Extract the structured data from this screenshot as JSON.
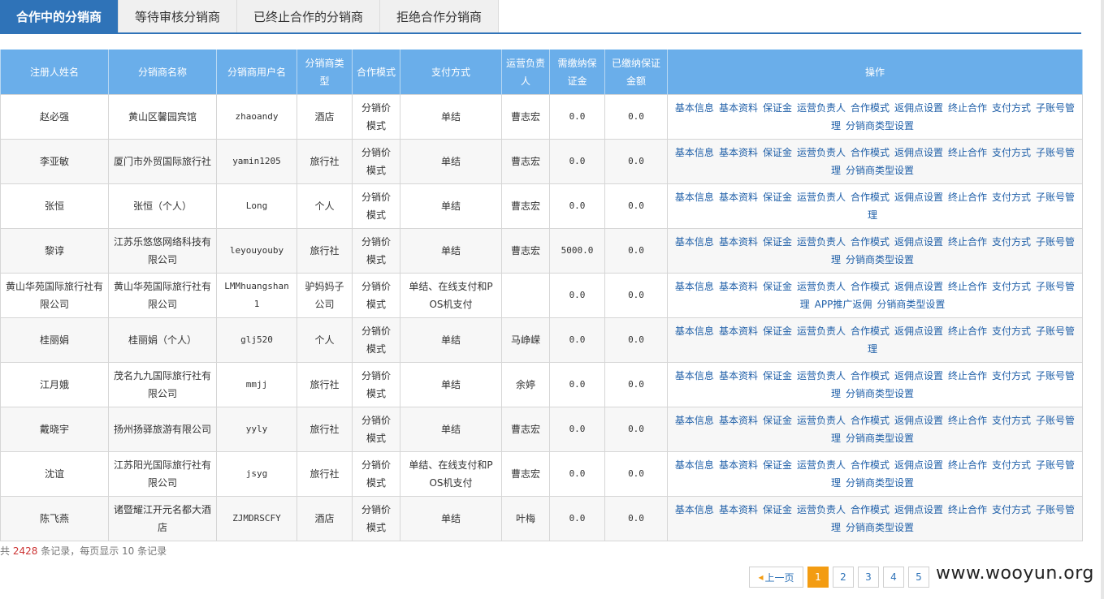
{
  "tabs": [
    {
      "label": "合作中的分销商",
      "active": true
    },
    {
      "label": "等待审核分销商",
      "active": false
    },
    {
      "label": "已终止合作的分销商",
      "active": false
    },
    {
      "label": "拒绝合作分销商",
      "active": false
    }
  ],
  "table": {
    "headers": [
      "注册人姓名",
      "分销商名称",
      "分销商用户名",
      "分销商类型",
      "合作模式",
      "支付方式",
      "运营负责人",
      "需缴纳保证金",
      "已缴纳保证金额",
      "操作"
    ],
    "rows": [
      {
        "registrant": "赵必强",
        "distributor_name": "黄山区馨园宾馆",
        "username": "zhaoandy",
        "type": "酒店",
        "mode": "分销价模式",
        "payment": "单结",
        "operator": "曹志宏",
        "deposit_required": "0.0",
        "deposit_paid": "0.0",
        "ops": [
          "基本信息",
          "基本资料",
          "保证金",
          "运营负责人",
          "合作模式",
          "返佣点设置",
          "终止合作",
          "支付方式",
          "子账号管理",
          "分销商类型设置"
        ]
      },
      {
        "registrant": "李亚敏",
        "distributor_name": "厦门市外贸国际旅行社",
        "username": "yamin1205",
        "type": "旅行社",
        "mode": "分销价模式",
        "payment": "单结",
        "operator": "曹志宏",
        "deposit_required": "0.0",
        "deposit_paid": "0.0",
        "ops": [
          "基本信息",
          "基本资料",
          "保证金",
          "运营负责人",
          "合作模式",
          "返佣点设置",
          "终止合作",
          "支付方式",
          "子账号管理",
          "分销商类型设置"
        ]
      },
      {
        "registrant": "张恒",
        "distributor_name": "张恒（个人）",
        "username": "Long",
        "type": "个人",
        "mode": "分销价模式",
        "payment": "单结",
        "operator": "曹志宏",
        "deposit_required": "0.0",
        "deposit_paid": "0.0",
        "ops": [
          "基本信息",
          "基本资料",
          "保证金",
          "运营负责人",
          "合作模式",
          "返佣点设置",
          "终止合作",
          "支付方式",
          "子账号管理"
        ]
      },
      {
        "registrant": "黎谆",
        "distributor_name": "江苏乐悠悠网络科技有限公司",
        "username": "leyouyouby",
        "type": "旅行社",
        "mode": "分销价模式",
        "payment": "单结",
        "operator": "曹志宏",
        "deposit_required": "5000.0",
        "deposit_paid": "0.0",
        "ops": [
          "基本信息",
          "基本资料",
          "保证金",
          "运营负责人",
          "合作模式",
          "返佣点设置",
          "终止合作",
          "支付方式",
          "子账号管理",
          "分销商类型设置"
        ]
      },
      {
        "registrant": "黄山华苑国际旅行社有限公司",
        "distributor_name": "黄山华苑国际旅行社有限公司",
        "username": "LMMhuangshan1",
        "type": "驴妈妈子公司",
        "mode": "分销价模式",
        "payment": "单结、在线支付和POS机支付",
        "operator": "",
        "deposit_required": "0.0",
        "deposit_paid": "0.0",
        "ops": [
          "基本信息",
          "基本资料",
          "保证金",
          "运营负责人",
          "合作模式",
          "返佣点设置",
          "终止合作",
          "支付方式",
          "子账号管理",
          "APP推广返佣",
          "分销商类型设置"
        ]
      },
      {
        "registrant": "桂丽娟",
        "distributor_name": "桂丽娟（个人）",
        "username": "glj520",
        "type": "个人",
        "mode": "分销价模式",
        "payment": "单结",
        "operator": "马峥嵘",
        "deposit_required": "0.0",
        "deposit_paid": "0.0",
        "ops": [
          "基本信息",
          "基本资料",
          "保证金",
          "运营负责人",
          "合作模式",
          "返佣点设置",
          "终止合作",
          "支付方式",
          "子账号管理"
        ]
      },
      {
        "registrant": "江月娥",
        "distributor_name": "茂名九九国际旅行社有限公司",
        "username": "mmjj",
        "type": "旅行社",
        "mode": "分销价模式",
        "payment": "单结",
        "operator": "余婷",
        "deposit_required": "0.0",
        "deposit_paid": "0.0",
        "ops": [
          "基本信息",
          "基本资料",
          "保证金",
          "运营负责人",
          "合作模式",
          "返佣点设置",
          "终止合作",
          "支付方式",
          "子账号管理",
          "分销商类型设置"
        ]
      },
      {
        "registrant": "戴晓宇",
        "distributor_name": "扬州扬驿旅游有限公司",
        "username": "yyly",
        "type": "旅行社",
        "mode": "分销价模式",
        "payment": "单结",
        "operator": "曹志宏",
        "deposit_required": "0.0",
        "deposit_paid": "0.0",
        "ops": [
          "基本信息",
          "基本资料",
          "保证金",
          "运营负责人",
          "合作模式",
          "返佣点设置",
          "终止合作",
          "支付方式",
          "子账号管理",
          "分销商类型设置"
        ]
      },
      {
        "registrant": "沈谊",
        "distributor_name": "江苏阳光国际旅行社有限公司",
        "username": "jsyg",
        "type": "旅行社",
        "mode": "分销价模式",
        "payment": "单结、在线支付和POS机支付",
        "operator": "曹志宏",
        "deposit_required": "0.0",
        "deposit_paid": "0.0",
        "ops": [
          "基本信息",
          "基本资料",
          "保证金",
          "运营负责人",
          "合作模式",
          "返佣点设置",
          "终止合作",
          "支付方式",
          "子账号管理",
          "分销商类型设置"
        ]
      },
      {
        "registrant": "陈飞燕",
        "distributor_name": "诸暨耀江开元名都大酒店",
        "username": "ZJMDRSCFY",
        "type": "酒店",
        "mode": "分销价模式",
        "payment": "单结",
        "operator": "叶梅",
        "deposit_required": "0.0",
        "deposit_paid": "0.0",
        "ops": [
          "基本信息",
          "基本资料",
          "保证金",
          "运营负责人",
          "合作模式",
          "返佣点设置",
          "终止合作",
          "支付方式",
          "子账号管理",
          "分销商类型设置"
        ]
      }
    ]
  },
  "summary": {
    "prefix": "共",
    "count": "2428",
    "suffix": "条记录，每页显示 10 条记录"
  },
  "pager": {
    "prev_label": "上一页",
    "pages": [
      "1",
      "2",
      "3",
      "4",
      "5"
    ],
    "current": "1"
  },
  "watermark": "www.wooyun.org"
}
